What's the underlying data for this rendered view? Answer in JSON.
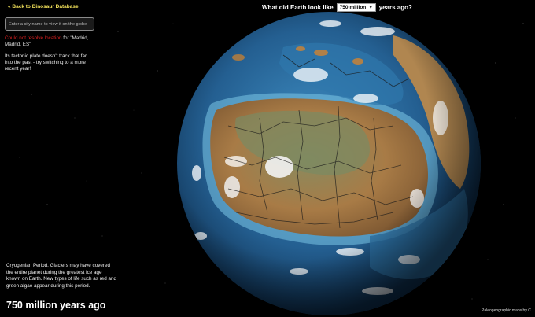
{
  "nav": {
    "back_label": "« Back to Dinosaur Database"
  },
  "header": {
    "prefix": "What did Earth look like",
    "selected_year": "750 million",
    "suffix": "years ago?"
  },
  "search": {
    "placeholder": "Enter a city name to view it on the globe",
    "value": ""
  },
  "error": {
    "red_part": "Could not resolve location",
    "rest": " for \"Madrid, Madrid, ES\""
  },
  "hint": "Its tectonic plate doesn't track that far into the past - try switching to a more recent year!",
  "period_description": "Cryogenian Period. Glaciers may have covered the entire planet during the greatest ice age known on Earth. New types of life such as red and green algae appear during this period.",
  "year_title": "750 million years ago",
  "credit": "Paleogeographic maps by C",
  "icons": {
    "dropdown": "chevron-down-icon"
  },
  "colors": {
    "background": "#000000",
    "link": "#f2e15a",
    "error": "#e02020",
    "ocean": "#1f5f8f",
    "land": "#a07440"
  }
}
